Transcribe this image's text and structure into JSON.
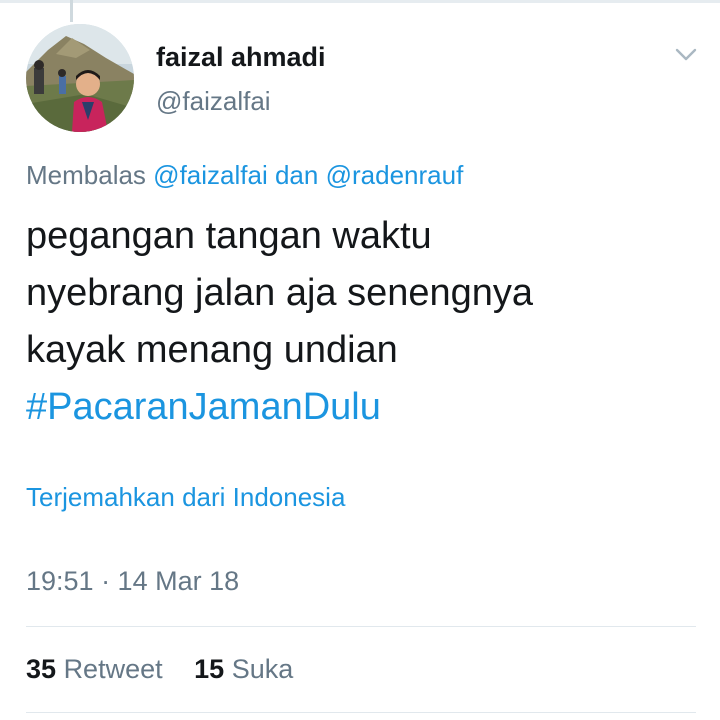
{
  "tweet": {
    "author": {
      "name": "faizal ahmadi",
      "handle": "@faizalfai"
    },
    "reply": {
      "prefix": "Membalas",
      "mention1": "@faizalfai",
      "joiner": "dan",
      "mention2": "@radenrauf"
    },
    "text": {
      "line1": "pegangan tangan waktu",
      "line2": "nyebrang jalan aja senengnya",
      "line3": "kayak menang undian",
      "hashtag": "#PacaranJamanDulu"
    },
    "translate_label": "Terjemahkan dari Indonesia",
    "timestamp": "19:51 · 14 Mar 18",
    "stats": {
      "retweet_count": "35",
      "retweet_label": "Retweet",
      "like_count": "15",
      "like_label": "Suka"
    }
  },
  "icons": {
    "menu": "chevron-down-icon"
  },
  "colors": {
    "link": "#1b95e0",
    "secondary_text": "#657786",
    "primary_text": "#14171a",
    "divider": "#e1e8ed"
  }
}
